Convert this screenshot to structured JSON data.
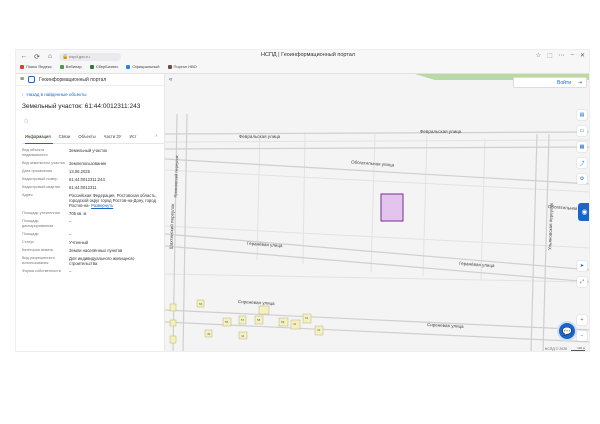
{
  "browser": {
    "address": "nspd.gov.ru",
    "window_title": "НСПД | Геоинформационный портал",
    "bookmarks": [
      {
        "label": "Поиск Яндекс",
        "color": "#e53935"
      },
      {
        "label": "Вебинар",
        "color": "#43a047"
      },
      {
        "label": "СберБизнес",
        "color": "#2e7d32"
      },
      {
        "label": "Официальный",
        "color": "#1e88e5"
      },
      {
        "label": "Портал НВО",
        "color": "#6d4c41"
      }
    ]
  },
  "panel": {
    "brand": "Геоинформационный портал",
    "back_link": "Назад в найденные объекты",
    "object_title": "Земельный участок: 61:44:0012311:243",
    "tabs": [
      "Информация",
      "Связи",
      "Объекты",
      "Части ЗУ",
      "Ист"
    ],
    "props": [
      {
        "key": "Вид объекта недвижимости",
        "value": "Земельный участок"
      },
      {
        "key": "Вид земельного участка",
        "value": "Землепользование"
      },
      {
        "key": "Дата присвоения",
        "value": "13.06.2025"
      },
      {
        "key": "Кадастровый номер",
        "value": "61:44:0012311:243"
      },
      {
        "key": "Кадастровый квартал",
        "value": "61:44:0012311"
      },
      {
        "key": "Адрес",
        "value": "Российская Федерация, Ростовская область, городской округ город Ростов-на-Дону, город Ростов-на-",
        "link": "Развернуть"
      },
      {
        "key": "Площадь уточненная",
        "value": "705 кв. м"
      },
      {
        "key": "Площадь декларированная",
        "value": "–"
      },
      {
        "key": "Площадь",
        "value": "–"
      },
      {
        "key": "Статус",
        "value": "Учтенный"
      },
      {
        "key": "Категория земель",
        "value": "Земли населённых пунктов"
      },
      {
        "key": "Вид разрешенного использования",
        "value": "Для индивидуального жилищного строительства"
      },
      {
        "key": "Форма собственности",
        "value": "–"
      }
    ]
  },
  "map": {
    "login_label": "Войти",
    "streets": {
      "s1": "Февральская улица",
      "s2": "Февральская улица",
      "s3": "Обогатильная улица",
      "s4": "Обогатильная",
      "s5": "Геранёвая улица",
      "s6": "Геранёвая улица",
      "s7": "Сиреневая улица",
      "s8": "Сиреневая улица",
      "v1": "Шахтинский переулок",
      "v2": "Приазовский переулок",
      "v3": "Ульяновская переулок"
    },
    "copyright": "НСПД © 2025",
    "scale": "100 м",
    "building_numbers": [
      "56",
      "55",
      "57",
      "58",
      "59",
      "51",
      "49",
      "41",
      "43",
      "44",
      "47",
      "21",
      "19",
      "17",
      "15",
      "13",
      "11",
      "9",
      "7",
      "5",
      "3",
      "1"
    ],
    "colors": {
      "parcel_fill": "#e4c3ef",
      "parcel_stroke": "#7a2b8f",
      "accent": "#1a66c8",
      "building": "#f4f1c0"
    }
  }
}
